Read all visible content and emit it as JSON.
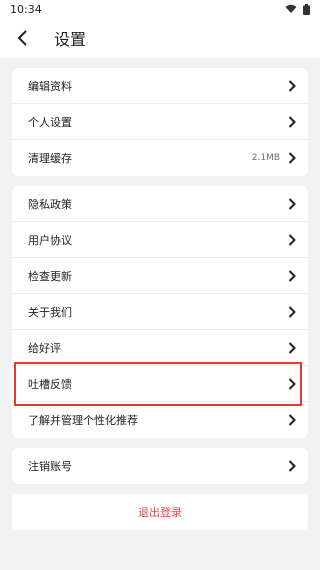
{
  "status": {
    "time": "10:34"
  },
  "header": {
    "title": "设置"
  },
  "group1": [
    {
      "label": "编辑资料",
      "value": ""
    },
    {
      "label": "个人设置",
      "value": ""
    },
    {
      "label": "清理缓存",
      "value": "2.1MB"
    }
  ],
  "group2": [
    {
      "label": "隐私政策"
    },
    {
      "label": "用户协议"
    },
    {
      "label": "检查更新"
    },
    {
      "label": "关于我们"
    },
    {
      "label": "给好评"
    },
    {
      "label": "吐槽反馈"
    },
    {
      "label": "了解并管理个性化推荐"
    }
  ],
  "group3": [
    {
      "label": "注销账号"
    }
  ],
  "logout": {
    "label": "退出登录"
  },
  "colors": {
    "highlight": "#e53935",
    "logout": "#e84b4b",
    "background": "#f2f2f2"
  }
}
